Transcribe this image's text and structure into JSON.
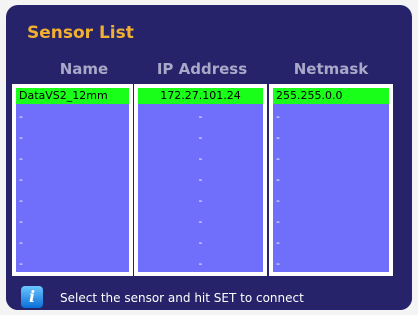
{
  "title": "Sensor List",
  "columns": {
    "name": "Name",
    "ip": "IP Address",
    "netmask": "Netmask"
  },
  "rows": [
    {
      "name": "DataVS2_12mm",
      "ip": "172.27.101.24",
      "netmask": "255.255.0.0",
      "selected": true
    },
    {
      "name": "-",
      "ip": "-",
      "netmask": "-"
    },
    {
      "name": "-",
      "ip": "-",
      "netmask": "-"
    },
    {
      "name": "-",
      "ip": "-",
      "netmask": "-"
    },
    {
      "name": "-",
      "ip": "-",
      "netmask": "-"
    },
    {
      "name": "-",
      "ip": "-",
      "netmask": "-"
    },
    {
      "name": "-",
      "ip": "-",
      "netmask": "-"
    },
    {
      "name": "-",
      "ip": "-",
      "netmask": "-"
    },
    {
      "name": "-",
      "ip": "-",
      "netmask": "-"
    }
  ],
  "status": {
    "icon": "info-icon",
    "message": "Select the sensor and hit SET to connect"
  },
  "colors": {
    "panel": "#26236a",
    "list": "#6f6ffb",
    "selected": "#1aff1a",
    "title": "#f2b030"
  }
}
